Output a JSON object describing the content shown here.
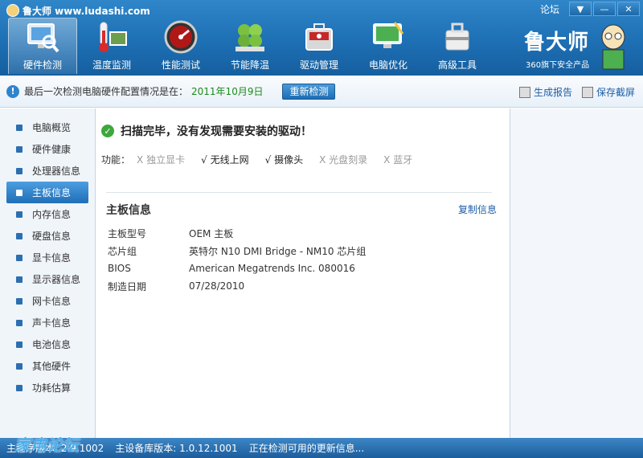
{
  "window": {
    "title": "鲁大师 www.ludashi.com",
    "forum": "论坛",
    "btn_menu": "▼",
    "btn_min": "—",
    "btn_close": "✕"
  },
  "nav": [
    {
      "label": "硬件检测",
      "icon": "monitor-magnifier-icon",
      "active": true
    },
    {
      "label": "温度监测",
      "icon": "thermometer-icon",
      "active": false
    },
    {
      "label": "性能测试",
      "icon": "speedometer-icon",
      "active": false
    },
    {
      "label": "节能降温",
      "icon": "clover-icon",
      "active": false
    },
    {
      "label": "驱动管理",
      "icon": "toolbox-icon",
      "active": false
    },
    {
      "label": "电脑优化",
      "icon": "broom-monitor-icon",
      "active": false
    },
    {
      "label": "高级工具",
      "icon": "tool-case-icon",
      "active": false
    }
  ],
  "brand": {
    "name": "鲁大师",
    "sub": "360旗下安全产品"
  },
  "infobar": {
    "text": "最后一次检测电脑硬件配置情况是在：",
    "date": "2011年10月9日",
    "rescan": "重新检测",
    "report": "生成报告",
    "screenshot": "保存截屏"
  },
  "sidebar": [
    "电脑概览",
    "硬件健康",
    "处理器信息",
    "主板信息",
    "内存信息",
    "硬盘信息",
    "显卡信息",
    "显示器信息",
    "网卡信息",
    "声卡信息",
    "电池信息",
    "其他硬件",
    "功耗估算"
  ],
  "sidebar_active": "主板信息",
  "main": {
    "status": "扫描完毕，没有发现需要安装的驱动！",
    "features_label": "功能：",
    "features": [
      {
        "mark": "X",
        "label": "独立显卡",
        "ok": false
      },
      {
        "mark": "√",
        "label": "无线上网",
        "ok": true
      },
      {
        "mark": "√",
        "label": "摄像头",
        "ok": true
      },
      {
        "mark": "X",
        "label": "光盘刻录",
        "ok": false
      },
      {
        "mark": "X",
        "label": "蓝牙",
        "ok": false
      }
    ],
    "section_title": "主板信息",
    "copy": "复制信息",
    "rows": [
      {
        "key": "主板型号",
        "value": "OEM 主板"
      },
      {
        "key": "芯片组",
        "value": "英特尔 N10 DMI Bridge - NM10 芯片组"
      },
      {
        "key": "BIOS",
        "value": "American Megatrends Inc. 080016"
      },
      {
        "key": "制造日期",
        "value": "07/28/2010"
      }
    ]
  },
  "statusbar": {
    "main_version": "主程序版本: 2.9.1002",
    "db_version": "主设备库版本: 1.0.12.1001",
    "update": "正在检测可用的更新信息..."
  },
  "watermark": "家电论坛"
}
